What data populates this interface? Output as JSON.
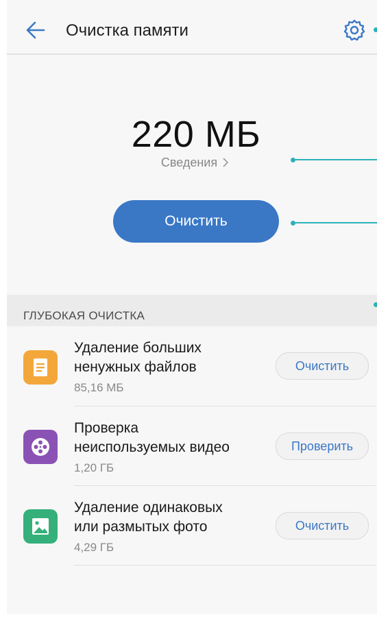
{
  "header": {
    "title": "Очистка памяти",
    "back_icon": "arrow-left-icon",
    "settings_icon": "gear-icon"
  },
  "summary": {
    "size": "220 МБ",
    "details_label": "Сведения",
    "clean_button_label": "Очистить"
  },
  "deep_clean": {
    "section_title": "ГЛУБОКАЯ ОЧИСТКА",
    "items": [
      {
        "title_line1": "Удаление больших",
        "title_line2": "ненужных файлов",
        "size": "85,16 МБ",
        "button_label": "Очистить",
        "icon": "document-icon",
        "icon_color": "#f3a73b"
      },
      {
        "title_line1": "Проверка",
        "title_line2": "неиспользуемых видео",
        "size": "1,20 ГБ",
        "button_label": "Проверить",
        "icon": "film-reel-icon",
        "icon_color": "#8b52b5"
      },
      {
        "title_line1": "Удаление одинаковых",
        "title_line2": "или размытых фото",
        "size": "4,29 ГБ",
        "button_label": "Очистить",
        "icon": "photo-icon",
        "icon_color": "#35b07a"
      }
    ]
  },
  "colors": {
    "accent": "#3a78c6",
    "callout": "#2ab1b8",
    "background": "#f7f7f7"
  }
}
